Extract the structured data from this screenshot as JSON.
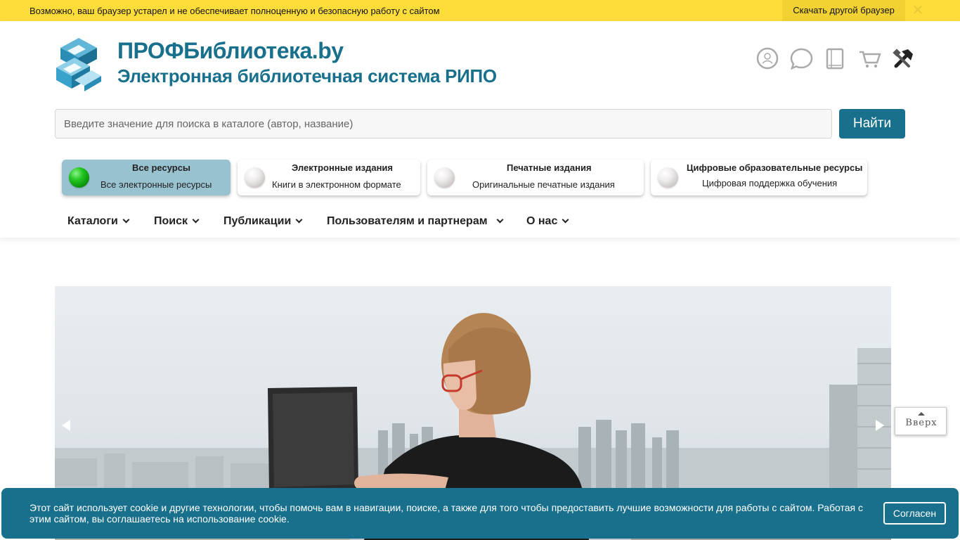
{
  "browser_warning": {
    "text": "Возможно, ваш браузер устарел и не обеспечивает полноценную и безопасную работу с сайтом",
    "download_label": "Скачать другой браузер",
    "close_glyph": "✕"
  },
  "brand": {
    "title": "ПРОФБиблиотека.by",
    "subtitle": "Электронная библиотечная система РИПО",
    "primary_color": "#19708d"
  },
  "top_icons": [
    "user-icon",
    "chat-icon",
    "book-icon",
    "cart-icon",
    "tools-icon"
  ],
  "search": {
    "placeholder": "Введите значение для поиска в каталоге (автор, название)",
    "value": "",
    "button_label": "Найти"
  },
  "resources": [
    {
      "title": "Все ресурсы",
      "desc": "Все электронные ресурсы",
      "active": true
    },
    {
      "title": "Электронные издания",
      "desc": "Книги в электронном формате",
      "active": false
    },
    {
      "title": "Печатные издания",
      "desc": "Оригинальные печатные издания",
      "active": false
    },
    {
      "title": "Цифровые образовательные ресурсы",
      "desc": "Цифровая поддержка обучения",
      "active": false
    }
  ],
  "nav": [
    {
      "label": "Каталоги"
    },
    {
      "label": "Поиск"
    },
    {
      "label": "Публикации"
    },
    {
      "label": "Пользователям и партнерам"
    },
    {
      "label": "О нас"
    }
  ],
  "back_to_top": {
    "label": "Вверх"
  },
  "cookie": {
    "text": "Этот сайт использует cookie и другие технологии, чтобы помочь вам в навигации, поиске, а также для того чтобы предоставить лучшие возможности для работы с сайтом. Работая с этим сайтом, вы соглашаетесь на использование cookie.",
    "accept_label": "Согласен"
  }
}
